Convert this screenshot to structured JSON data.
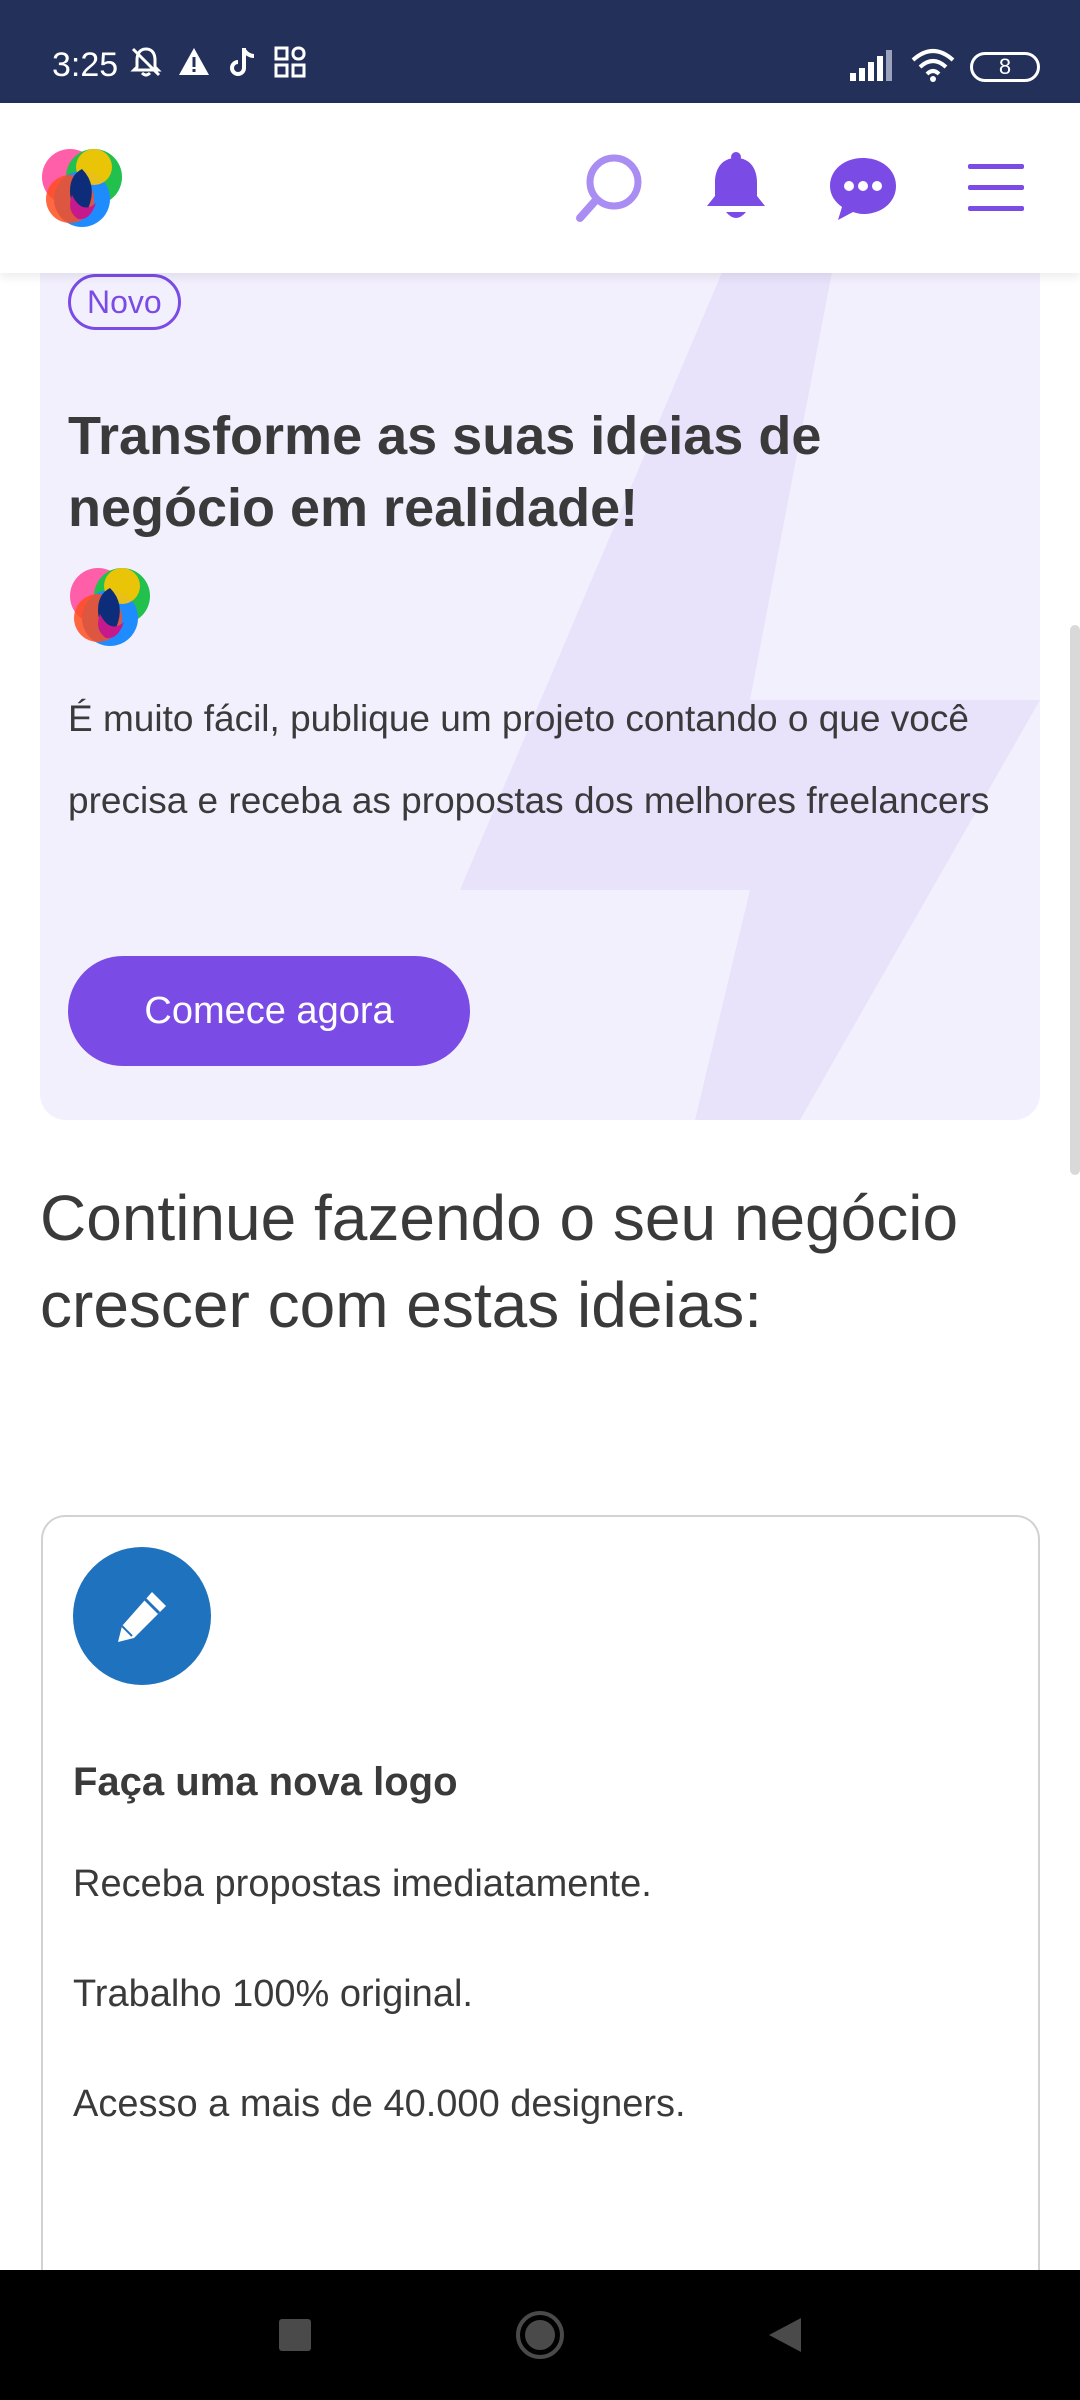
{
  "status_bar": {
    "time": "3:25",
    "battery": "8",
    "left_icons": [
      "mute-icon",
      "warning-icon",
      "tiktok-icon",
      "apps-icon"
    ],
    "right_icons": [
      "signal-icon",
      "wifi-icon",
      "battery-icon"
    ]
  },
  "header": {
    "icons": [
      "app-logo-icon",
      "search-icon",
      "bell-icon",
      "chat-icon",
      "menu-icon"
    ],
    "accent_color": "#7b4be6"
  },
  "promo": {
    "badge": "Novo",
    "title": "Transforme as suas ideias de negócio em realidade!",
    "text": "É muito fácil, publique um projeto contando o que você precisa e receba as propostas dos melhores freelancers",
    "button": "Comece agora",
    "background_color": "#f3f0fe"
  },
  "section": {
    "heading": "Continue fazendo o seu negócio crescer com estas ideias:"
  },
  "idea_card": {
    "icon": "pencil-icon",
    "icon_color": "#1f72bd",
    "title": "Faça uma nova logo",
    "lines": [
      "Receba propostas imediatamente.",
      "Trabalho 100% original.",
      "Acesso a mais de 40.000 designers."
    ]
  },
  "nav_bar": {
    "buttons": [
      "recent-apps-icon",
      "home-icon",
      "back-icon"
    ]
  }
}
